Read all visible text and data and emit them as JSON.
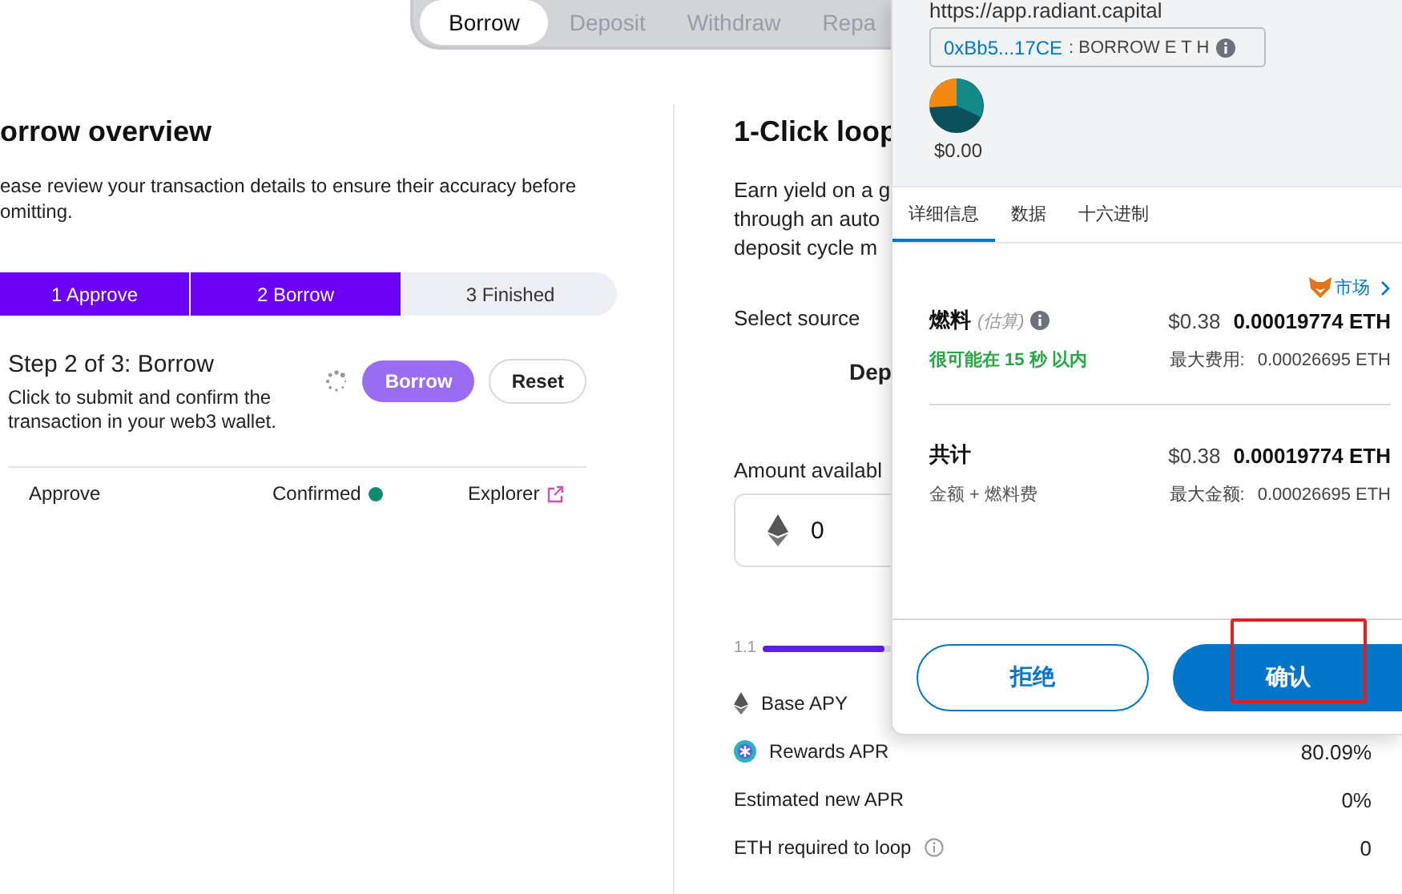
{
  "tabs": [
    {
      "label": "Borrow",
      "selected": true
    },
    {
      "label": "Deposit",
      "selected": false
    },
    {
      "label": "Withdraw",
      "selected": false
    },
    {
      "label": "Repa",
      "selected": false
    }
  ],
  "overview": {
    "title": "orrow overview",
    "description": "ease review your transaction details to ensure their accuracy before\nomitting.",
    "steps": [
      {
        "label": "1 Approve",
        "completed": true
      },
      {
        "label": "2 Borrow",
        "completed": true
      },
      {
        "label": "3 Finished",
        "completed": false
      }
    ],
    "step_title": "Step 2 of 3: Borrow",
    "step_description": "Click to submit and confirm the\ntransaction in your web3 wallet.",
    "loading": true,
    "primary_button": "Borrow",
    "secondary_button": "Reset",
    "transactions": [
      {
        "label": "Approve",
        "status": "Confirmed",
        "color": "#0e8a6e",
        "link": "Explorer"
      }
    ]
  },
  "loop": {
    "title": "1-Click loop",
    "description": "Earn yield on a g\nthrough an auto\ndeposit cycle m",
    "source_label": "Select source",
    "source_option": "Dep",
    "amount_label": "Amount availabl",
    "amount_value": "0",
    "leverage_min": "1.1",
    "leverage_slider": {
      "level": 0.2
    },
    "stats": [
      {
        "kind": "eth",
        "label": "Base APY"
      },
      {
        "kind": "rewards",
        "label": "Rewards APR",
        "value": "80.09%"
      },
      {
        "kind": "plain",
        "label": "Estimated new APR",
        "value": "0%"
      },
      {
        "kind": "info",
        "label": "ETH required to loop",
        "value": "0"
      }
    ]
  },
  "wallet_popup": {
    "origin": "https://app.radiant.capital",
    "address": "0xBb5...17CE",
    "method": ": BORROW E T H",
    "balance": "$0.00",
    "tabs": [
      {
        "label": "详细信息",
        "selected": true
      },
      {
        "label": "数据",
        "selected": false
      },
      {
        "label": "十六进制",
        "selected": false
      }
    ],
    "market_link": "市场",
    "fees": [
      {
        "kind": "gas",
        "label": "燃料",
        "hint": "(估算)",
        "fiat": "$0.38",
        "amount": "0.00019774 ETH",
        "note": "很可能在 15 秒 以内",
        "max_label": "最大费用:",
        "max_value": "0.00026695 ETH"
      },
      {
        "kind": "total",
        "label": "共计",
        "fiat": "$0.38",
        "amount": "0.00019774 ETH",
        "note": "金额 + 燃料费",
        "max_label": "最大金额:",
        "max_value": "0.00026695 ETH"
      }
    ],
    "reject_button": "拒绝",
    "confirm_button": "确认",
    "confirm_highlighted": true
  }
}
